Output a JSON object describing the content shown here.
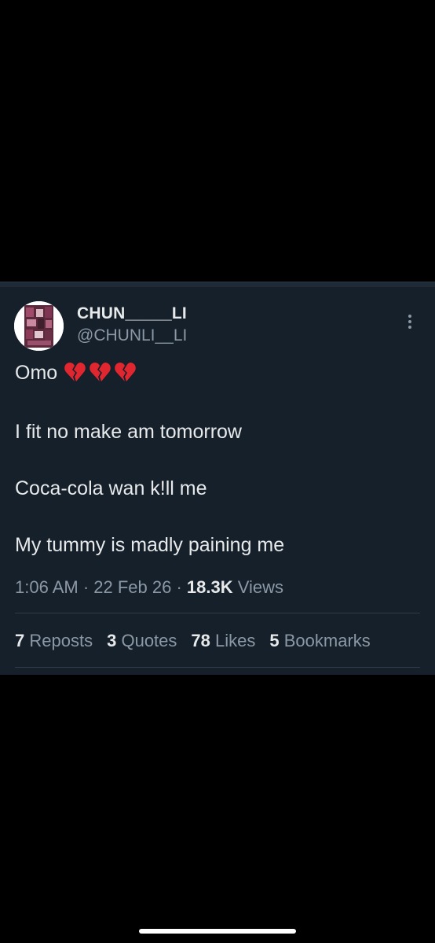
{
  "tweet": {
    "display_name": "CHUN_____LI",
    "handle": "@CHUNLI__LI",
    "lines": [
      "Omo",
      "I fit no make am tomorrow",
      "Coca-cola wan k!ll me",
      "My tummy is madly paining me"
    ],
    "emojis": [
      "broken-heart-icon",
      "broken-heart-icon",
      "broken-heart-icon"
    ],
    "time": "1:06 AM",
    "date": "22 Feb 26",
    "views_count": "18.3K",
    "views_label": "Views",
    "separator": " · "
  },
  "stats": {
    "reposts_count": "7",
    "reposts_label": "Reposts",
    "quotes_count": "3",
    "quotes_label": "Quotes",
    "likes_count": "78",
    "likes_label": "Likes",
    "bookmarks_count": "5",
    "bookmarks_label": "Bookmarks"
  },
  "colors": {
    "card_bg": "#15202b",
    "primary_text": "#e7e9ea",
    "secondary_text": "#8b98a5",
    "heart": "#e0262e"
  }
}
